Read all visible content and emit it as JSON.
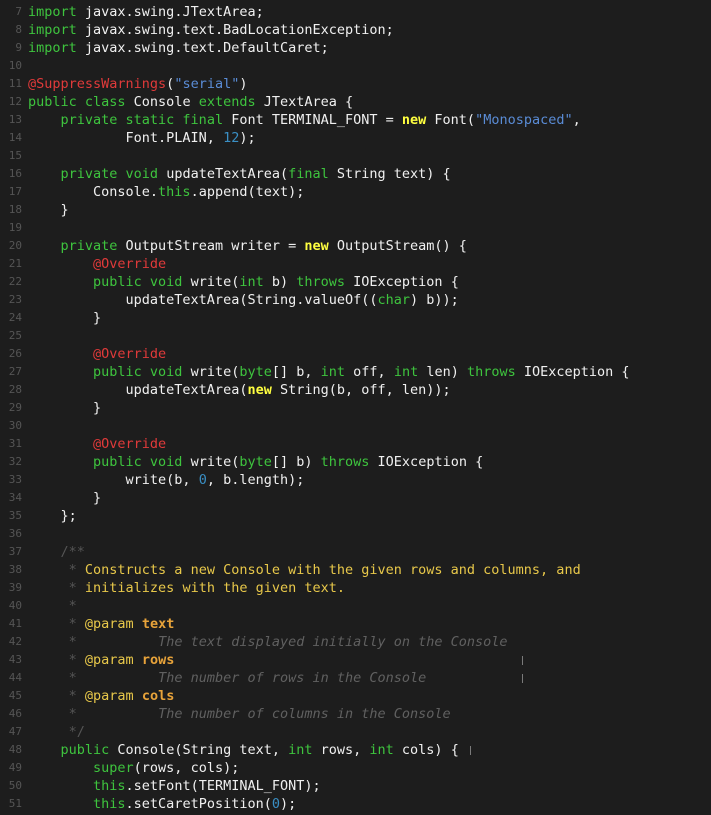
{
  "editor": {
    "language": "java",
    "colors": {
      "background": "#1d1d1d",
      "text": "#f0f0f0",
      "keyword": "#3ec43e",
      "new_keyword": "#ffff40",
      "string": "#5a8cd6",
      "annotation": "#e03a3a",
      "number": "#3a8fc4",
      "doc_text": "#e8c84a",
      "doc_tag": "#e8a33a",
      "line_number": "#555555"
    },
    "lines": [
      {
        "n": "7",
        "tokens": [
          {
            "t": "kw",
            "v": "import"
          },
          {
            "t": "plain",
            "v": " javax.swing.JTextArea;"
          }
        ]
      },
      {
        "n": "8",
        "tokens": [
          {
            "t": "kw",
            "v": "import"
          },
          {
            "t": "plain",
            "v": " javax.swing.text.BadLocationException;"
          }
        ]
      },
      {
        "n": "9",
        "tokens": [
          {
            "t": "kw",
            "v": "import"
          },
          {
            "t": "plain",
            "v": " javax.swing.text.DefaultCaret;"
          }
        ]
      },
      {
        "n": "10",
        "tokens": []
      },
      {
        "n": "11",
        "tokens": [
          {
            "t": "ann",
            "v": "@SuppressWarnings"
          },
          {
            "t": "plain",
            "v": "("
          },
          {
            "t": "str",
            "v": "\"serial\""
          },
          {
            "t": "plain",
            "v": ")"
          }
        ]
      },
      {
        "n": "12",
        "tokens": [
          {
            "t": "kw",
            "v": "public class"
          },
          {
            "t": "plain",
            "v": " Console "
          },
          {
            "t": "kw",
            "v": "extends"
          },
          {
            "t": "plain",
            "v": " JTextArea {"
          }
        ]
      },
      {
        "n": "13",
        "tokens": [
          {
            "t": "plain",
            "v": "    "
          },
          {
            "t": "kw",
            "v": "private static final"
          },
          {
            "t": "plain",
            "v": " Font TERMINAL_FONT = "
          },
          {
            "t": "new",
            "v": "new"
          },
          {
            "t": "plain",
            "v": " Font("
          },
          {
            "t": "str",
            "v": "\"Monospaced\""
          },
          {
            "t": "plain",
            "v": ","
          }
        ]
      },
      {
        "n": "14",
        "tokens": [
          {
            "t": "plain",
            "v": "            Font.PLAIN, "
          },
          {
            "t": "num",
            "v": "12"
          },
          {
            "t": "plain",
            "v": ");"
          }
        ]
      },
      {
        "n": "15",
        "tokens": []
      },
      {
        "n": "16",
        "tokens": [
          {
            "t": "plain",
            "v": "    "
          },
          {
            "t": "kw",
            "v": "private void"
          },
          {
            "t": "plain",
            "v": " updateTextArea("
          },
          {
            "t": "kw",
            "v": "final"
          },
          {
            "t": "plain",
            "v": " String text) {"
          }
        ]
      },
      {
        "n": "17",
        "tokens": [
          {
            "t": "plain",
            "v": "        Console."
          },
          {
            "t": "kw",
            "v": "this"
          },
          {
            "t": "plain",
            "v": ".append(text);"
          }
        ]
      },
      {
        "n": "18",
        "tokens": [
          {
            "t": "plain",
            "v": "    }"
          }
        ]
      },
      {
        "n": "19",
        "tokens": []
      },
      {
        "n": "20",
        "tokens": [
          {
            "t": "plain",
            "v": "    "
          },
          {
            "t": "kw",
            "v": "private"
          },
          {
            "t": "plain",
            "v": " OutputStream writer = "
          },
          {
            "t": "new",
            "v": "new"
          },
          {
            "t": "plain",
            "v": " OutputStream() {"
          }
        ]
      },
      {
        "n": "21",
        "tokens": [
          {
            "t": "plain",
            "v": "        "
          },
          {
            "t": "ann",
            "v": "@Override"
          }
        ]
      },
      {
        "n": "22",
        "tokens": [
          {
            "t": "plain",
            "v": "        "
          },
          {
            "t": "kw",
            "v": "public void"
          },
          {
            "t": "plain",
            "v": " write("
          },
          {
            "t": "kw",
            "v": "int"
          },
          {
            "t": "plain",
            "v": " b) "
          },
          {
            "t": "kw",
            "v": "throws"
          },
          {
            "t": "plain",
            "v": " IOException {"
          }
        ]
      },
      {
        "n": "23",
        "tokens": [
          {
            "t": "plain",
            "v": "            updateTextArea(String.valueOf(("
          },
          {
            "t": "kw",
            "v": "char"
          },
          {
            "t": "plain",
            "v": ") b));"
          }
        ]
      },
      {
        "n": "24",
        "tokens": [
          {
            "t": "plain",
            "v": "        }"
          }
        ]
      },
      {
        "n": "25",
        "tokens": []
      },
      {
        "n": "26",
        "tokens": [
          {
            "t": "plain",
            "v": "        "
          },
          {
            "t": "ann",
            "v": "@Override"
          }
        ]
      },
      {
        "n": "27",
        "tokens": [
          {
            "t": "plain",
            "v": "        "
          },
          {
            "t": "kw",
            "v": "public void"
          },
          {
            "t": "plain",
            "v": " write("
          },
          {
            "t": "kw",
            "v": "byte"
          },
          {
            "t": "plain",
            "v": "[] b, "
          },
          {
            "t": "kw",
            "v": "int"
          },
          {
            "t": "plain",
            "v": " off, "
          },
          {
            "t": "kw",
            "v": "int"
          },
          {
            "t": "plain",
            "v": " len) "
          },
          {
            "t": "kw",
            "v": "throws"
          },
          {
            "t": "plain",
            "v": " IOException {"
          }
        ]
      },
      {
        "n": "28",
        "tokens": [
          {
            "t": "plain",
            "v": "            updateTextArea("
          },
          {
            "t": "new",
            "v": "new"
          },
          {
            "t": "plain",
            "v": " String(b, off, len));"
          }
        ]
      },
      {
        "n": "29",
        "tokens": [
          {
            "t": "plain",
            "v": "        }"
          }
        ]
      },
      {
        "n": "30",
        "tokens": []
      },
      {
        "n": "31",
        "tokens": [
          {
            "t": "plain",
            "v": "        "
          },
          {
            "t": "ann",
            "v": "@Override"
          }
        ]
      },
      {
        "n": "32",
        "tokens": [
          {
            "t": "plain",
            "v": "        "
          },
          {
            "t": "kw",
            "v": "public void"
          },
          {
            "t": "plain",
            "v": " write("
          },
          {
            "t": "kw",
            "v": "byte"
          },
          {
            "t": "plain",
            "v": "[] b) "
          },
          {
            "t": "kw",
            "v": "throws"
          },
          {
            "t": "plain",
            "v": " IOException {"
          }
        ]
      },
      {
        "n": "33",
        "tokens": [
          {
            "t": "plain",
            "v": "            write(b, "
          },
          {
            "t": "num",
            "v": "0"
          },
          {
            "t": "plain",
            "v": ", b.length);"
          }
        ]
      },
      {
        "n": "34",
        "tokens": [
          {
            "t": "plain",
            "v": "        }"
          }
        ]
      },
      {
        "n": "35",
        "tokens": [
          {
            "t": "plain",
            "v": "    };"
          }
        ]
      },
      {
        "n": "36",
        "tokens": []
      },
      {
        "n": "37",
        "tokens": [
          {
            "t": "plain",
            "v": "    "
          },
          {
            "t": "com",
            "v": "/**"
          }
        ]
      },
      {
        "n": "38",
        "tokens": [
          {
            "t": "plain",
            "v": "     "
          },
          {
            "t": "com",
            "v": "* "
          },
          {
            "t": "doc",
            "v": "Constructs a new Console with the given rows and columns, and"
          }
        ]
      },
      {
        "n": "39",
        "tokens": [
          {
            "t": "plain",
            "v": "     "
          },
          {
            "t": "com",
            "v": "* "
          },
          {
            "t": "doc",
            "v": "initializes with the given text."
          }
        ]
      },
      {
        "n": "40",
        "tokens": [
          {
            "t": "plain",
            "v": "     "
          },
          {
            "t": "com",
            "v": "*"
          }
        ]
      },
      {
        "n": "41",
        "tokens": [
          {
            "t": "plain",
            "v": "     "
          },
          {
            "t": "com",
            "v": "* "
          },
          {
            "t": "doc",
            "v": "@param "
          },
          {
            "t": "tag",
            "v": "text"
          }
        ]
      },
      {
        "n": "42",
        "tokens": [
          {
            "t": "plain",
            "v": "     "
          },
          {
            "t": "com",
            "v": "*"
          },
          {
            "t": "plain",
            "v": "          "
          },
          {
            "t": "ital",
            "v": "The text displayed initially on the Console"
          }
        ]
      },
      {
        "n": "43",
        "tokens": [
          {
            "t": "plain",
            "v": "     "
          },
          {
            "t": "com",
            "v": "* "
          },
          {
            "t": "doc",
            "v": "@param "
          },
          {
            "t": "tag",
            "v": "rows"
          }
        ]
      },
      {
        "n": "44",
        "tokens": [
          {
            "t": "plain",
            "v": "     "
          },
          {
            "t": "com",
            "v": "*"
          },
          {
            "t": "plain",
            "v": "          "
          },
          {
            "t": "ital",
            "v": "The number of rows in the Console"
          }
        ]
      },
      {
        "n": "45",
        "tokens": [
          {
            "t": "plain",
            "v": "     "
          },
          {
            "t": "com",
            "v": "* "
          },
          {
            "t": "doc",
            "v": "@param "
          },
          {
            "t": "tag",
            "v": "cols"
          }
        ]
      },
      {
        "n": "46",
        "tokens": [
          {
            "t": "plain",
            "v": "     "
          },
          {
            "t": "com",
            "v": "*"
          },
          {
            "t": "plain",
            "v": "          "
          },
          {
            "t": "ital",
            "v": "The number of columns in the Console"
          }
        ]
      },
      {
        "n": "47",
        "tokens": [
          {
            "t": "plain",
            "v": "     "
          },
          {
            "t": "com",
            "v": "*/"
          }
        ]
      },
      {
        "n": "48",
        "tokens": [
          {
            "t": "plain",
            "v": "    "
          },
          {
            "t": "kw",
            "v": "public"
          },
          {
            "t": "plain",
            "v": " Console(String text, "
          },
          {
            "t": "kw",
            "v": "int"
          },
          {
            "t": "plain",
            "v": " rows, "
          },
          {
            "t": "kw",
            "v": "int"
          },
          {
            "t": "plain",
            "v": " cols) {"
          }
        ]
      },
      {
        "n": "49",
        "tokens": [
          {
            "t": "plain",
            "v": "        "
          },
          {
            "t": "kw",
            "v": "super"
          },
          {
            "t": "plain",
            "v": "(rows, cols);"
          }
        ]
      },
      {
        "n": "50",
        "tokens": [
          {
            "t": "plain",
            "v": "        "
          },
          {
            "t": "kw",
            "v": "this"
          },
          {
            "t": "plain",
            "v": ".setFont(TERMINAL_FONT);"
          }
        ]
      },
      {
        "n": "51",
        "tokens": [
          {
            "t": "plain",
            "v": "        "
          },
          {
            "t": "kw",
            "v": "this"
          },
          {
            "t": "plain",
            "v": ".setCaretPosition("
          },
          {
            "t": "num",
            "v": "0"
          },
          {
            "t": "plain",
            "v": ");"
          }
        ]
      }
    ]
  }
}
